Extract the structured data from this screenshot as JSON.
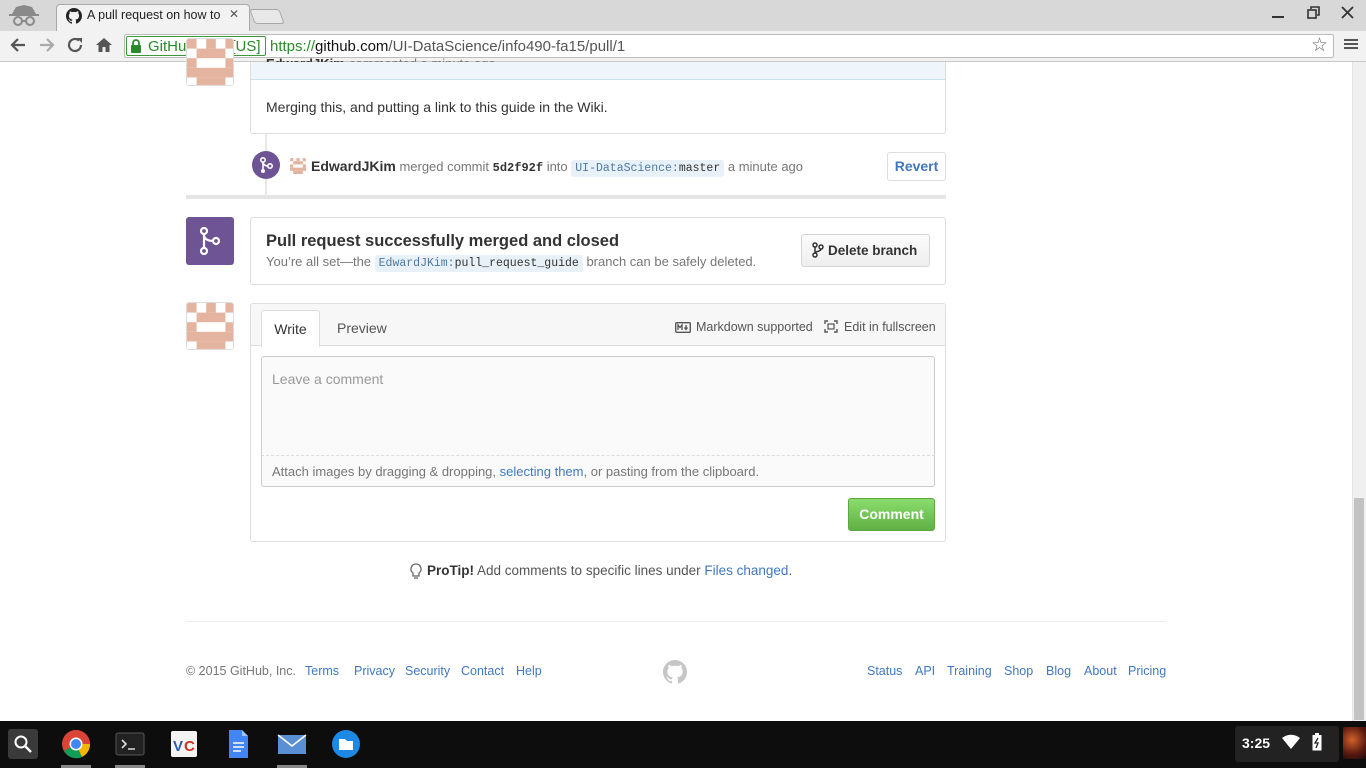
{
  "browser": {
    "tab_title": "A pull request on how to",
    "close_glyph": "✕",
    "ev_cert": "GitHub, Inc. [US]",
    "url_scheme": "https://",
    "url_host": "github.com",
    "url_path": "/UI-DataScience/info490-fa15/pull/1",
    "window_controls": [
      "minimize",
      "restore",
      "close"
    ]
  },
  "comment": {
    "author": "EdwardJKim",
    "action": "commented a minute ago",
    "body": "Merging this, and putting a link to this guide in the Wiki."
  },
  "merge_event": {
    "user": "EdwardJKim",
    "verb": "merged commit",
    "sha": "5d2f92f",
    "into": "into",
    "ref_repo": "UI-DataScience",
    "ref_sep": ":",
    "ref_branch": "master",
    "time": "a minute ago",
    "revert_label": "Revert"
  },
  "merged_box": {
    "title": "Pull request successfully merged and closed",
    "sub_before": "You’re all set—the",
    "branch_user": "EdwardJKim",
    "branch_sep": ":",
    "branch_name": "pull_request_guide",
    "sub_after": "branch can be safely deleted.",
    "delete_label": "Delete branch"
  },
  "comment_form": {
    "tab_write": "Write",
    "tab_preview": "Preview",
    "markdown_label": "Markdown supported",
    "fullscreen_label": "Edit in fullscreen",
    "placeholder": "Leave a comment",
    "attach_before": "Attach images by dragging & dropping,",
    "attach_link": "selecting them",
    "attach_after": ", or pasting from the clipboard.",
    "submit_label": "Comment"
  },
  "protip": {
    "label": "ProTip!",
    "text": "Add comments to specific lines under",
    "link": "Files changed",
    "end": "."
  },
  "footer": {
    "copyright": "© 2015 GitHub, Inc.",
    "left_links": [
      "Terms",
      "Privacy",
      "Security",
      "Contact",
      "Help"
    ],
    "right_links": [
      "Status",
      "API",
      "Training",
      "Shop",
      "Blog",
      "About",
      "Pricing"
    ]
  },
  "shelf": {
    "apps": [
      "chrome-icon",
      "terminal-icon",
      "vnc-icon",
      "docs-icon",
      "mail-icon",
      "files-icon"
    ],
    "clock": "3:25"
  },
  "colors": {
    "merged_purple": "#6e5494",
    "link_blue": "#4078c0",
    "comment_green": "#60b044",
    "ev_green": "#2b8a2b"
  }
}
